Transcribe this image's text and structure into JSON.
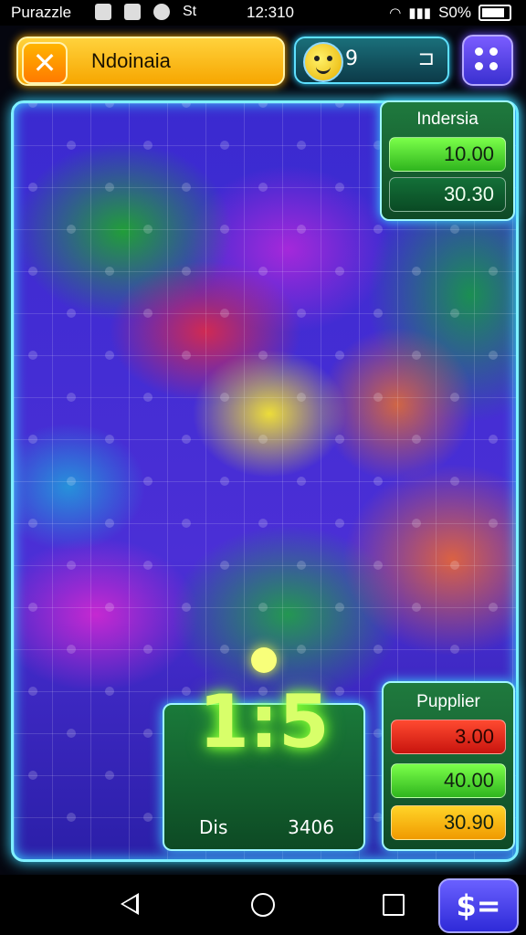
{
  "status_bar": {
    "app_name": "Purazzle",
    "time": "12:310",
    "battery": "S0%",
    "icon_text": "St"
  },
  "header": {
    "title": "Ndoinaia",
    "close_icon": "✕",
    "score": "9",
    "score_suffix": "⊐"
  },
  "top_panel": {
    "title": "Indersia",
    "values": [
      "10.00",
      "30.30"
    ]
  },
  "bottom_panel": {
    "title": "Pupplier",
    "values": [
      "3.00",
      "40.00",
      "30.90"
    ]
  },
  "timer": {
    "big": "1:5",
    "label": "Dis",
    "value": "3406"
  },
  "nav": {
    "cash_label": "$="
  },
  "colors": {
    "accent": "#7ff0ff",
    "board_base": "#3a2ad0",
    "title_pill": "#ffc21a"
  }
}
